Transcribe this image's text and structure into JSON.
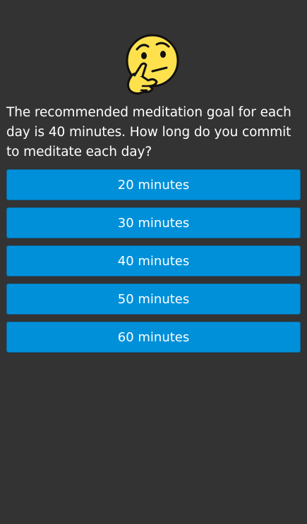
{
  "emoji": {
    "icon": "thinking-face-icon",
    "colors": {
      "face": "#ffe14d",
      "outline": "#111111"
    }
  },
  "question": "The recommended meditation goal for each day is 40 minutes. How long do you commit to meditate each day?",
  "options": [
    {
      "label": "20 minutes"
    },
    {
      "label": "30 minutes"
    },
    {
      "label": "40 minutes"
    },
    {
      "label": "50 minutes"
    },
    {
      "label": "60 minutes"
    }
  ],
  "colors": {
    "background": "#333333",
    "button": "#0090d9",
    "text": "#ffffff"
  }
}
